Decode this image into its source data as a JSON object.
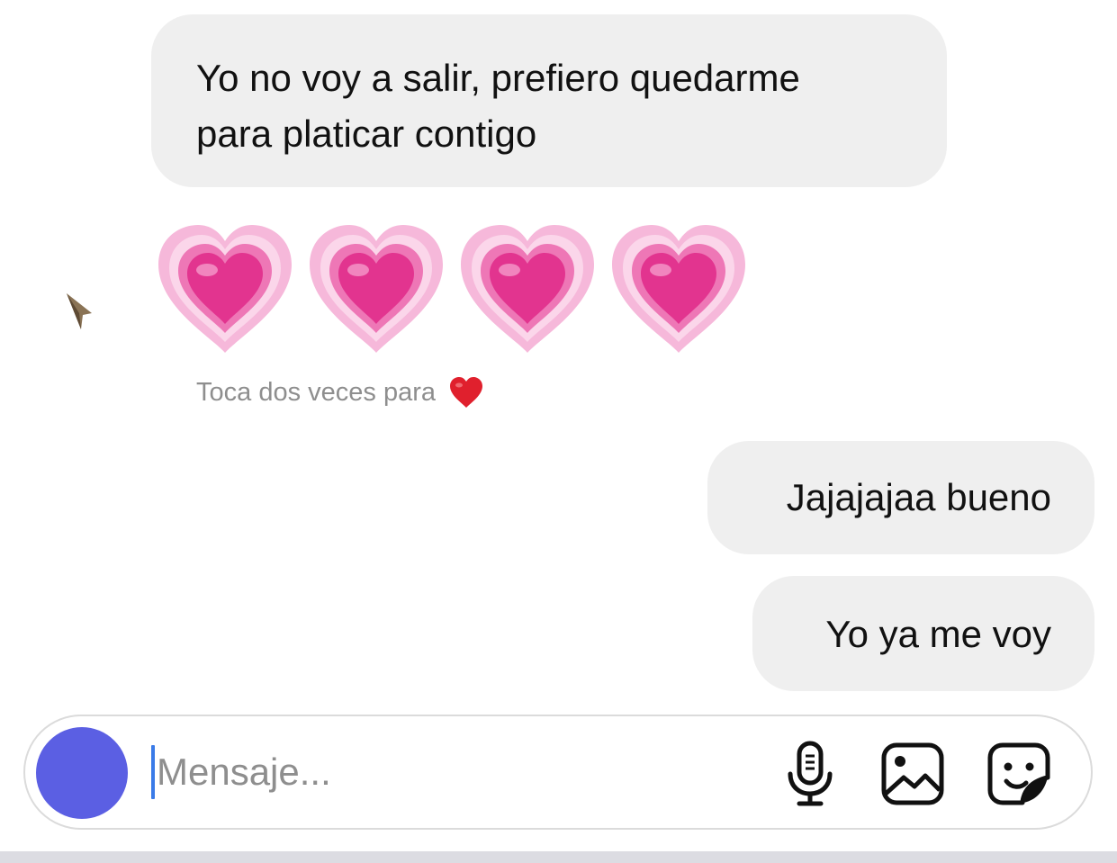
{
  "conversation": {
    "messages": [
      {
        "sender": "them",
        "lines": [
          "Yo no voy a salir, prefiero quedarme",
          "para platicar contigo"
        ]
      },
      {
        "sender": "them",
        "emoji": [
          "growing-heart",
          "growing-heart",
          "growing-heart",
          "growing-heart"
        ],
        "hint": "Toca dos veces para",
        "hint_icon": "red-heart-icon"
      },
      {
        "sender": "me",
        "text": "Jajajajaa bueno"
      },
      {
        "sender": "me",
        "text": "Yo ya me voy"
      }
    ]
  },
  "composer": {
    "placeholder": "Mensaje...",
    "value": "",
    "avatar_color": "#5b5fe3",
    "tools": [
      "microphone-icon",
      "gallery-icon",
      "sticker-icon"
    ]
  },
  "colors": {
    "bubble_background": "#efefef",
    "hint_text": "#8e8e8e",
    "heart_pink": "#e2348f",
    "heart_red": "#e0202d"
  }
}
